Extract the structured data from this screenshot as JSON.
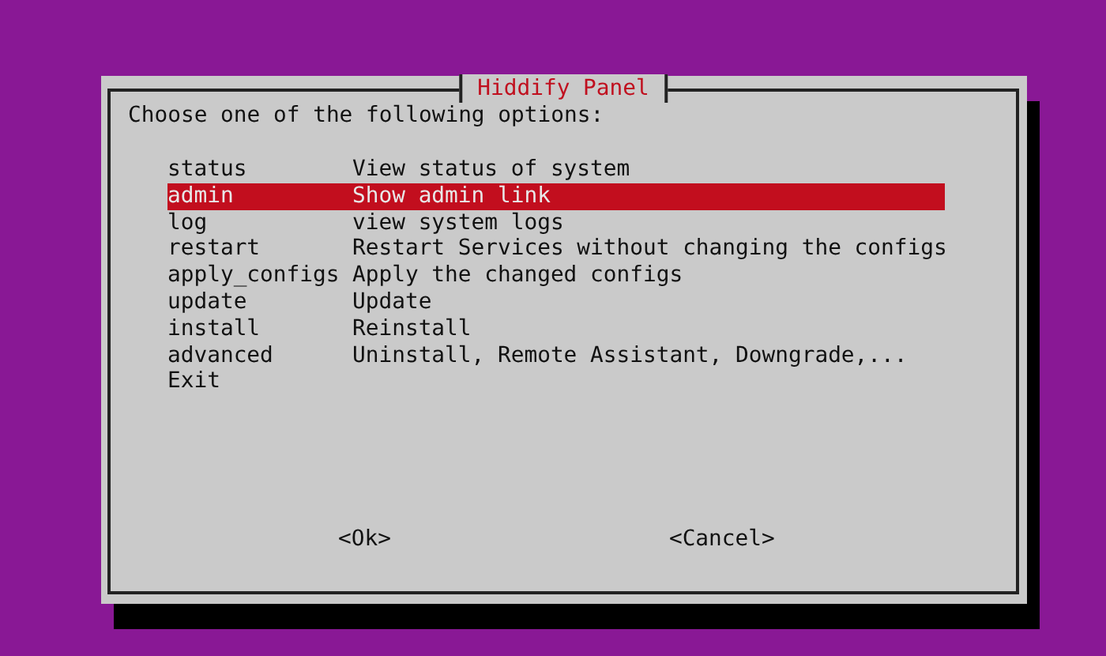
{
  "dialog": {
    "title": "Hiddify Panel",
    "prompt": "Choose one of the following options:",
    "items": [
      {
        "name": "status",
        "description": "View status of system",
        "selected": false
      },
      {
        "name": "admin",
        "description": "Show admin link",
        "selected": true
      },
      {
        "name": "log",
        "description": "view system logs",
        "selected": false
      },
      {
        "name": "restart",
        "description": "Restart Services without changing the configs",
        "selected": false
      },
      {
        "name": "apply_configs",
        "description": "Apply the changed configs",
        "selected": false
      },
      {
        "name": "update",
        "description": "Update",
        "selected": false
      },
      {
        "name": "install",
        "description": "Reinstall",
        "selected": false
      },
      {
        "name": "advanced",
        "description": "Uninstall, Remote Assistant, Downgrade,...",
        "selected": false
      },
      {
        "name": "Exit",
        "selected": false
      }
    ],
    "buttons": [
      {
        "label": "<Ok>"
      },
      {
        "label": "<Cancel>"
      }
    ]
  }
}
